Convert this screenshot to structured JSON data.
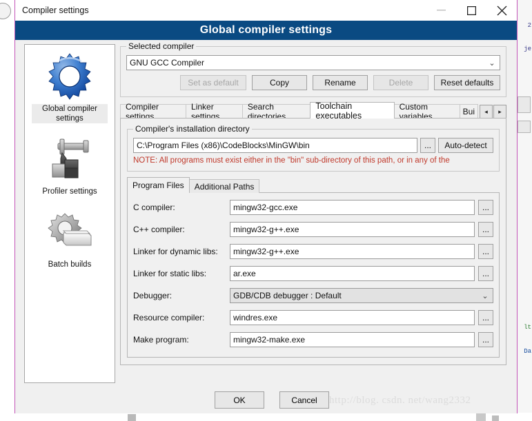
{
  "window": {
    "title": "Compiler settings",
    "controls": {
      "minimize": "—",
      "maximize": "maximize-icon",
      "close": "✕"
    }
  },
  "header": {
    "title": "Global compiler settings"
  },
  "sidebar": {
    "items": [
      {
        "label": "Global compiler settings",
        "icon": "blue-gear-icon",
        "selected": true
      },
      {
        "label": "Profiler settings",
        "icon": "caliper-blocks-icon",
        "selected": false
      },
      {
        "label": "Batch builds",
        "icon": "gear-stack-icon",
        "selected": false
      }
    ]
  },
  "selected_compiler": {
    "legend": "Selected compiler",
    "value": "GNU GCC Compiler",
    "buttons": [
      {
        "label": "Set as default",
        "disabled": true
      },
      {
        "label": "Copy",
        "disabled": false
      },
      {
        "label": "Rename",
        "disabled": false
      },
      {
        "label": "Delete",
        "disabled": true
      },
      {
        "label": "Reset defaults",
        "disabled": false
      }
    ]
  },
  "tabs": {
    "items": [
      {
        "label": "Compiler settings",
        "active": false
      },
      {
        "label": "Linker settings",
        "active": false
      },
      {
        "label": "Search directories",
        "active": false
      },
      {
        "label": "Toolchain executables",
        "active": true
      },
      {
        "label": "Custom variables",
        "active": false
      },
      {
        "label": "Bui",
        "active": false
      }
    ],
    "scroll_left": "◂",
    "scroll_right": "▸"
  },
  "install_dir": {
    "legend": "Compiler's installation directory",
    "value": "C:\\Program Files (x86)\\CodeBlocks\\MinGW\\bin",
    "browse_label": "...",
    "autodetect_label": "Auto-detect",
    "note": "NOTE: All programs must exist either in the \"bin\" sub-directory of this path, or in any of the"
  },
  "inner_tabs": [
    {
      "label": "Program Files",
      "active": true
    },
    {
      "label": "Additional Paths",
      "active": false
    }
  ],
  "program_files": {
    "browse_label": "...",
    "chevron": "⌄",
    "fields": [
      {
        "label": "C compiler:",
        "value": "mingw32-gcc.exe",
        "type": "text"
      },
      {
        "label": "C++ compiler:",
        "value": "mingw32-g++.exe",
        "type": "text"
      },
      {
        "label": "Linker for dynamic libs:",
        "value": "mingw32-g++.exe",
        "type": "text"
      },
      {
        "label": "Linker for static libs:",
        "value": "ar.exe",
        "type": "text"
      },
      {
        "label": "Debugger:",
        "value": "GDB/CDB debugger : Default",
        "type": "combo"
      },
      {
        "label": "Resource compiler:",
        "value": "windres.exe",
        "type": "text"
      },
      {
        "label": "Make program:",
        "value": "mingw32-make.exe",
        "type": "text"
      }
    ]
  },
  "footer": {
    "ok_label": "OK",
    "cancel_label": "Cancel",
    "watermark": "http://blog. csdn. net/wang2332"
  },
  "background": {
    "snippets": [
      "2",
      "je",
      "lt",
      "Da"
    ]
  },
  "colors": {
    "header_blue": "#0a4a82",
    "dialog_border": "#c355b8",
    "note_red": "#c0392b",
    "face": "#f0f0f0"
  }
}
